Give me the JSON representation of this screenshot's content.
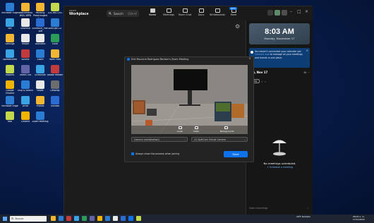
{
  "desktop": {
    "icons": [
      {
        "label": "Microsoft Edge",
        "color": "#2b7cd3"
      },
      {
        "label": "Attachments WGU WPD",
        "color": "#f2b632"
      },
      {
        "label": "Pending Prearranged Pa...",
        "color": "#f2b632"
      },
      {
        "label": "TDL-IMS DOC",
        "color": "#c2d94c"
      },
      {
        "label": "Bin",
        "color": "#3aa3e3"
      },
      {
        "label": "Shortcut",
        "color": "#e8e8e8"
      },
      {
        "label": "Schedule_Plan.pdf",
        "color": "#2b6cd3"
      },
      {
        "label": "DevOps CLI",
        "color": "#2b7cd3"
      },
      {
        "label": "Settings",
        "color": "#f2b632"
      },
      {
        "label": "Helper",
        "color": "#e8e8e8"
      },
      {
        "label": "Assistant",
        "color": "#e8e8e8"
      },
      {
        "label": "Excel",
        "color": "#2b9b58"
      },
      {
        "label": "Spreadsheet",
        "color": "#3aa3e3"
      },
      {
        "label": "Access",
        "color": "#c23a3a"
      },
      {
        "label": "Zoom",
        "color": "#2b7cd3"
      },
      {
        "label": "Work Files",
        "color": "#f2b632"
      },
      {
        "label": "Reports",
        "color": "#c2d94c"
      },
      {
        "label": "Teams Old",
        "color": "#6264a7"
      },
      {
        "label": "Scheduler",
        "color": "#3aa3e3"
      },
      {
        "label": "Adobe Reader",
        "color": "#c23a3a"
      },
      {
        "label": "Google Chrome",
        "color": "#f0b400"
      },
      {
        "label": "Snip & Sketch",
        "color": "#2b7cd3"
      },
      {
        "label": "Notes",
        "color": "#e8e8e8"
      },
      {
        "label": "Desktop",
        "color": "#6d6d6d"
      },
      {
        "label": "Microsoft Edge",
        "color": "#2b7cd3"
      },
      {
        "label": "Drive",
        "color": "#3aa3e3"
      },
      {
        "label": "Photos",
        "color": "#f2b632"
      },
      {
        "label": "Outlook",
        "color": "#2b6cd3"
      },
      {
        "label": "Mail",
        "color": "#c2d94c"
      },
      {
        "label": "Chrome",
        "color": "#f0b400"
      },
      {
        "label": "Zoom Meeting",
        "color": "#2b7cd3"
      }
    ]
  },
  "zoom": {
    "brand_small": "zoom",
    "brand_name": "Workplace",
    "search_label": "Search",
    "search_shortcut": "Ctrl+F",
    "nav": [
      {
        "label": "Home",
        "active": true
      },
      {
        "label": "Meetings",
        "active": false
      },
      {
        "label": "Team Chat",
        "active": false
      },
      {
        "label": "Docs",
        "active": false
      },
      {
        "label": "Whiteboards",
        "active": false
      },
      {
        "label": "More",
        "active": false
      }
    ],
    "new_badge": "NEW",
    "clock": {
      "time": "8:03 AM",
      "date": "Monday, November 17"
    },
    "calendar_notice": {
      "text_before": "You haven't connected your calendar yet. ",
      "link": "Connect now",
      "text_after": " to manage all your meetings and events in one place."
    },
    "day_header": "day, Nov 17",
    "today_label": "Today",
    "no_meetings": "No meetings scheduled.",
    "schedule_link": "+ Schedule a meeting",
    "open_recordings": "Open recordings"
  },
  "dialog": {
    "title": "Erik Mauricio Rodriguez Borbon's Zoom Meeting",
    "controls": [
      {
        "label": "Audio"
      },
      {
        "label": "Video"
      },
      {
        "label": "Backgrounds"
      }
    ],
    "camera_select": "Camera (combination)",
    "mic_select": "(1) SplitCam Virtual Camera",
    "always_preview_label": "Always show this preview when joining",
    "start_button": "Start"
  },
  "taskbar": {
    "search_placeholder": "Buscar",
    "tray_text_1": "20ºC Nublado",
    "tray_time": "08:03 a. m.",
    "tray_date": "17/11/2025"
  }
}
